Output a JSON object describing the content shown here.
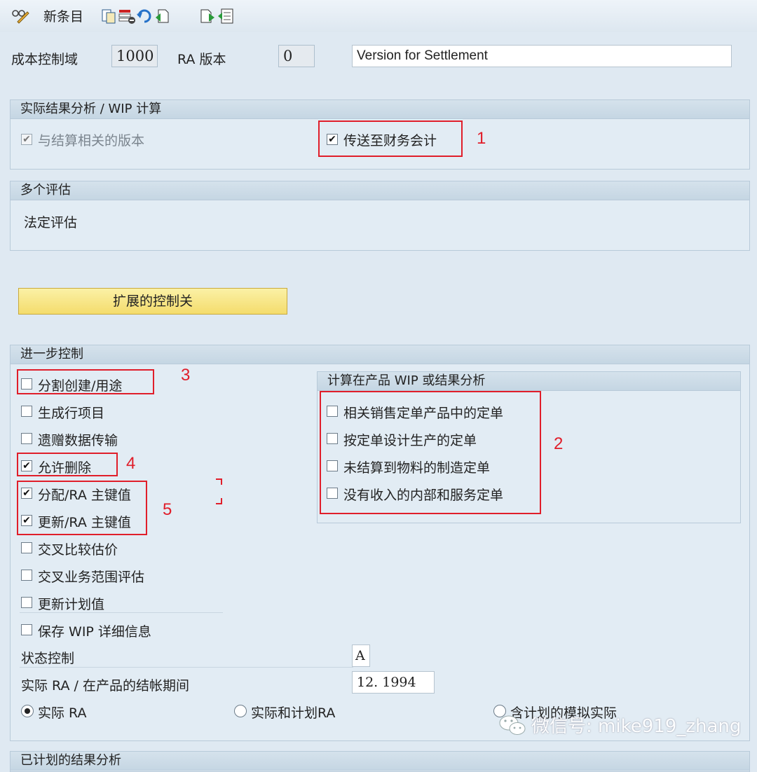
{
  "toolbar": {
    "new_entry": "新条目"
  },
  "header": {
    "controlling_area_label": "成本控制域",
    "controlling_area_value": "1000",
    "ra_version_label": "RA 版本",
    "ra_version_value": "0",
    "ra_version_text": "Version for Settlement"
  },
  "group_actual": {
    "title": "实际结果分析 / WIP 计算",
    "settlement_version_label": "与结算相关的版本",
    "transfer_fi_label": "传送至财务会计"
  },
  "group_multi": {
    "title": "多个评估",
    "legal_valuation": "法定评估"
  },
  "extended_button": "扩展的控制关",
  "group_further": {
    "title": "进一步控制",
    "items": [
      {
        "label": "分割创建/用途",
        "checked": false
      },
      {
        "label": "生成行项目",
        "checked": false
      },
      {
        "label": "遗赠数据传输",
        "checked": false
      },
      {
        "label": "允许删除",
        "checked": true
      },
      {
        "label": "分配/RA 主键值",
        "checked": true
      },
      {
        "label": "更新/RA 主键值",
        "checked": true
      },
      {
        "label": "交叉比较估价",
        "checked": false
      },
      {
        "label": "交叉业务范围评估",
        "checked": false
      },
      {
        "label": "更新计划值",
        "checked": false
      },
      {
        "label": "保存 WIP 详细信息",
        "checked": false
      }
    ],
    "status_control_label": "状态控制",
    "status_control_value": "A",
    "period_label": "实际 RA / 在产品的结帐期间",
    "period_value": "12. 1994",
    "radio_actual": "实际 RA",
    "radio_actual_plan": "实际和计划RA",
    "radio_sim": "含计划的模拟实际"
  },
  "subgroup_calc": {
    "title": "计算在产品 WIP 或结果分析",
    "items": [
      "相关销售定单产品中的定单",
      "按定单设计生产的定单",
      "未结算到物料的制造定单",
      "没有收入的内部和服务定单"
    ]
  },
  "annotations": {
    "n1": "1",
    "n2": "2",
    "n3": "3",
    "n4": "4",
    "n5": "5"
  },
  "bottom_group_title": "已计划的结果分析",
  "watermark": "微信号: mike919_zhang",
  "colors": {
    "annotation_red": "#e01e2a",
    "button_yellow": "#f4dc6c",
    "background": "#dfe9f2"
  }
}
